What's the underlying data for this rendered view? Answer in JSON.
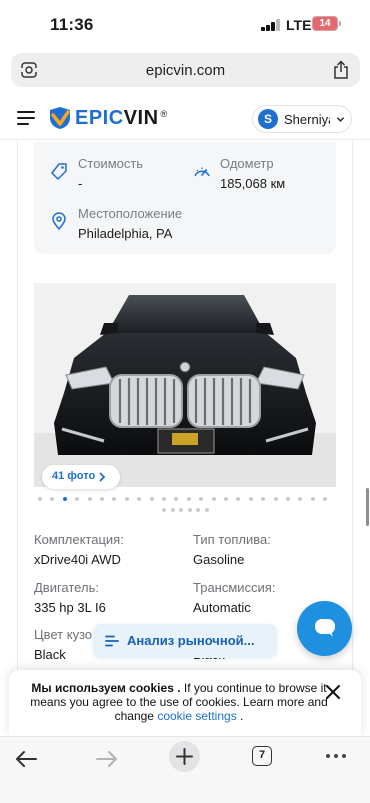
{
  "status_bar": {
    "time": "11:36",
    "network": "LTE",
    "battery": "14"
  },
  "browser": {
    "url": "epicvin.com"
  },
  "header": {
    "logo_prefix": "EPIC",
    "logo_suffix": "VIN",
    "logo_mark": "®",
    "user_initial": "S",
    "user_name": "Sherniyaz"
  },
  "summary": {
    "price_label": "Стоимость",
    "price_value": "-",
    "odometer_label": "Одометр",
    "odometer_value": "185,068 км",
    "location_label": "Местоположение",
    "location_value": "Philadelphia, PA"
  },
  "gallery": {
    "photos_badge": "41 фото",
    "total_dots": 30,
    "active_dot": 3
  },
  "specs": {
    "trim_label": "Комплектация:",
    "trim_value": "xDrive40i AWD",
    "fuel_label": "Тип топлива:",
    "fuel_value": "Gasoline",
    "engine_label": "Двигатель:",
    "engine_value": "335 hp 3L I6",
    "transmission_label": "Трансмиссия:",
    "transmission_value": "Automatic",
    "color_label": "Цвет кузо",
    "color_value": "Black",
    "interior_value_partial": "Black"
  },
  "market_button": "Анализ рыночной...",
  "cookie": {
    "bold": "Мы используем cookies .",
    "text1": " If you continue to browse it means you agree to the use of cookies. Learn more and change ",
    "link": "cookie settings",
    "text2": " ."
  },
  "toolbar": {
    "tab_count": "7"
  },
  "colors": {
    "accent": "#1e6fd1",
    "fab": "#1f8fe0",
    "card_bg": "#f4f6f8"
  }
}
